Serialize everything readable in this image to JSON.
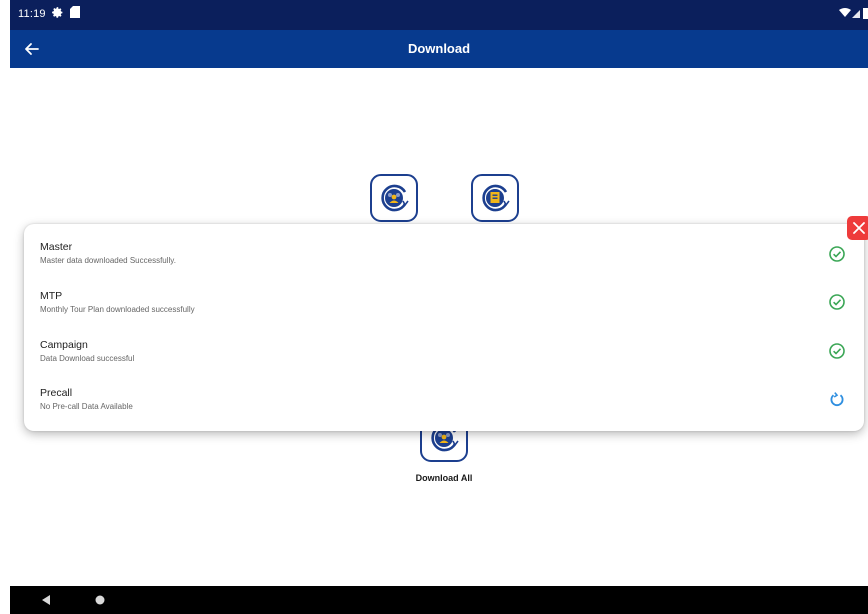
{
  "status_bar": {
    "time": "11:19",
    "icons": [
      "gear-icon",
      "sim-card-icon",
      "wifi-icon",
      "signal-icon",
      "battery-icon"
    ]
  },
  "app_bar": {
    "title": "Download",
    "back_icon": "arrow-left-icon",
    "background_color": "#073a8e"
  },
  "tiles": [
    {
      "name": "master",
      "icon": "team-sync-download-icon"
    },
    {
      "name": "mtp",
      "icon": "document-sync-download-icon"
    },
    {
      "name": "download-all",
      "icon": "team-sync-download-icon"
    }
  ],
  "download_all": {
    "label": "Download All"
  },
  "status_panel": {
    "close_icon": "close-icon",
    "close_color": "#ee3b3b",
    "rows": [
      {
        "title": "Master",
        "subtitle": "Master data downloaded Successfully.",
        "status_icon": "check-circle-icon",
        "status_color": "#3aa655"
      },
      {
        "title": "MTP",
        "subtitle": "Monthly Tour Plan downloaded successfully",
        "status_icon": "check-circle-icon",
        "status_color": "#3aa655"
      },
      {
        "title": "Campaign",
        "subtitle": "Data Download successful",
        "status_icon": "check-circle-icon",
        "status_color": "#3aa655"
      },
      {
        "title": "Precall",
        "subtitle": "No Pre-call Data Available",
        "status_icon": "refresh-icon",
        "status_color": "#2f8fe0"
      }
    ]
  },
  "nav_bar": {
    "icons": [
      "nav-back-icon",
      "nav-home-icon"
    ]
  }
}
